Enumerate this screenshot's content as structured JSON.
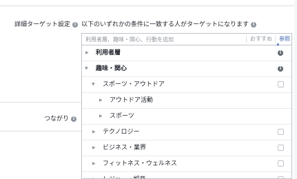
{
  "section": {
    "detailed_label": "詳細ターゲット設定",
    "connections_label": "つながり",
    "description": "以下のいずれかの条件に一致する人がターゲットになります",
    "info_glyph": "i"
  },
  "search": {
    "placeholder": "利用者層、趣味・関心、行動を追加",
    "value": "",
    "suggestions_label": "おすすめ",
    "browse_label": "参照",
    "browse_caret": "▲"
  },
  "categories": {
    "demographics": "利用者層",
    "interests": "趣味・関心",
    "sports_outdoors": "スポーツ・アウトドア",
    "outdoor_activities": "アウトドア活動",
    "sports": "スポーツ",
    "technology": "テクノロジー",
    "business_industry": "ビジネス・業界",
    "fitness_wellness": "フィットネス・ウェルネス",
    "leisure_entertainment": "レジャー・娯楽"
  },
  "glyphs": {
    "collapsed": "▶",
    "expanded": "▼"
  },
  "colors": {
    "link": "#4267b2",
    "border": "#bec3c9",
    "text": "#1d2129",
    "muted": "#90949c"
  }
}
